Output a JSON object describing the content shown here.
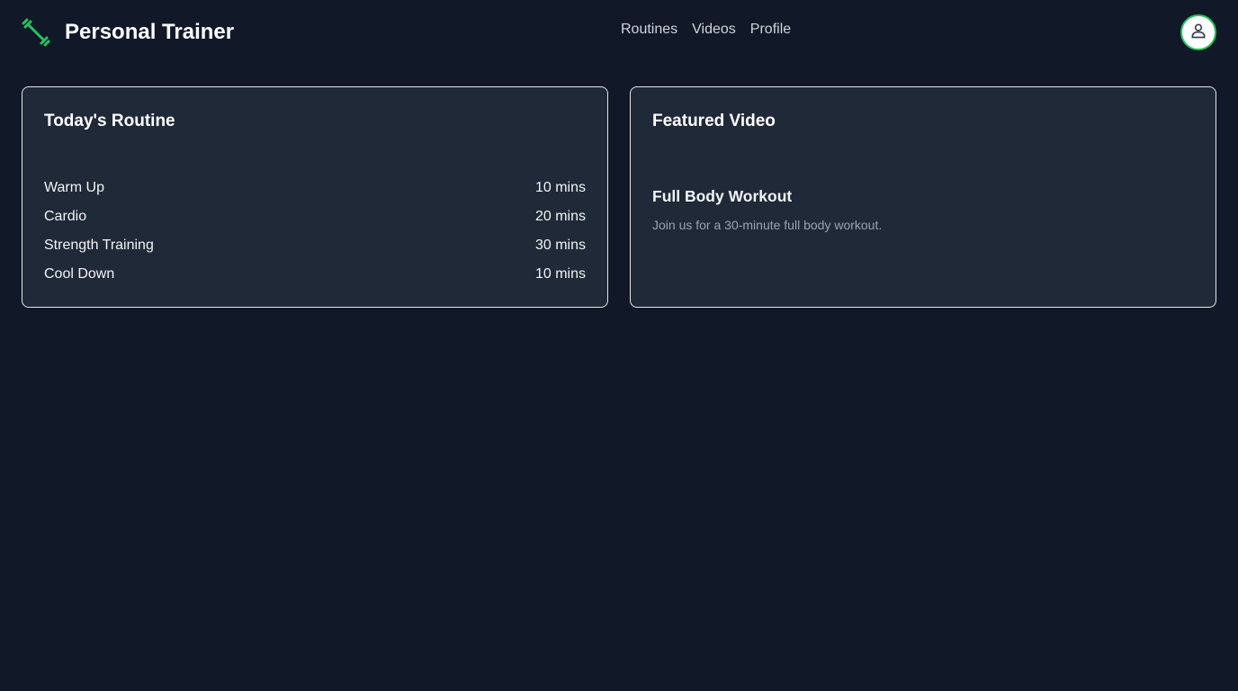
{
  "header": {
    "brand_title": "Personal Trainer",
    "brand_icon": "dumbbell-icon",
    "accent_color": "#22c55e",
    "nav": [
      {
        "label": "Routines"
      },
      {
        "label": "Videos"
      },
      {
        "label": "Profile"
      }
    ],
    "avatar_icon": "user-icon"
  },
  "routine": {
    "title": "Today's Routine",
    "items": [
      {
        "name": "Warm Up",
        "duration": "10 mins"
      },
      {
        "name": "Cardio",
        "duration": "20 mins"
      },
      {
        "name": "Strength Training",
        "duration": "30 mins"
      },
      {
        "name": "Cool Down",
        "duration": "10 mins"
      }
    ]
  },
  "featured": {
    "title": "Featured Video",
    "video_title": "Full Body Workout",
    "video_description": "Join us for a 30-minute full body workout."
  },
  "colors": {
    "background": "#111827",
    "card": "#1f2937",
    "card_border": "#e5e7eb",
    "muted_text": "#9ca3af"
  }
}
